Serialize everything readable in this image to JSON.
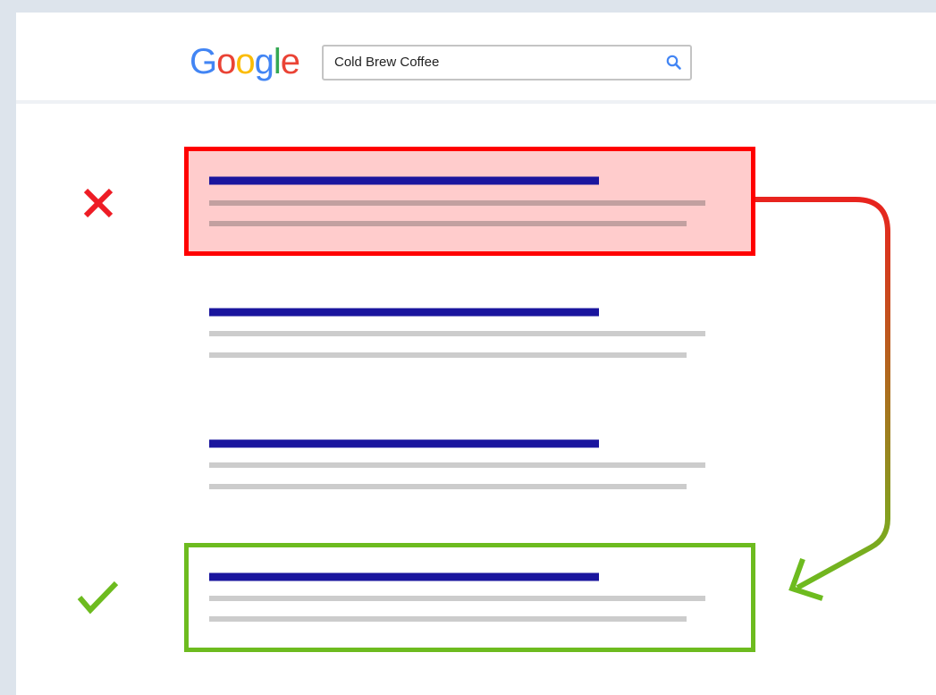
{
  "header": {
    "logo": {
      "letters": [
        {
          "char": "G",
          "color": "#4285F4"
        },
        {
          "char": "o",
          "color": "#EA4335"
        },
        {
          "char": "o",
          "color": "#FBBC05"
        },
        {
          "char": "g",
          "color": "#4285F4"
        },
        {
          "char": "l",
          "color": "#34A853"
        },
        {
          "char": "e",
          "color": "#EA4335"
        }
      ]
    },
    "search": {
      "query": "Cold Brew Coffee",
      "icon": "search-icon",
      "icon_color": "#4285F4"
    }
  },
  "results": [
    {
      "name": "result-1",
      "state": "bad"
    },
    {
      "name": "result-2",
      "state": "normal"
    },
    {
      "name": "result-3",
      "state": "normal"
    },
    {
      "name": "result-4",
      "state": "good"
    }
  ],
  "markers": {
    "bad": {
      "icon": "cross-icon",
      "color": "#ee1c25"
    },
    "good": {
      "icon": "check-icon",
      "color": "#6dbb1f"
    }
  },
  "colors": {
    "title_line": "#1a159e",
    "snippet_line": "#cccccc",
    "bad_border": "#ff0000",
    "bad_fill": "#ffcccc",
    "bad_snippet": "#c2a0a0",
    "good_border": "#6dbb1f",
    "arrow_start": "#e8231e",
    "arrow_end": "#6dbb1f"
  },
  "arrow": {
    "icon": "curved-arrow-icon",
    "from": "result-1",
    "to": "result-4"
  }
}
